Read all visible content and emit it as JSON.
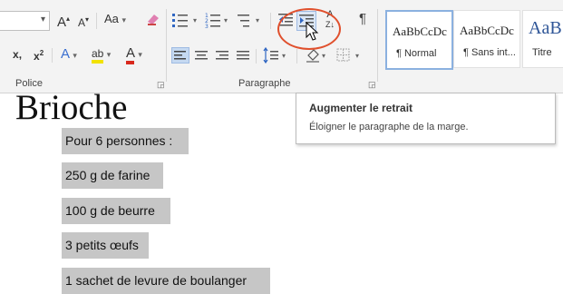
{
  "ribbon": {
    "font_group": {
      "label": "Police",
      "grow_font": "A",
      "shrink_font": "A",
      "change_case": "Aa",
      "subscript": "x",
      "superscript": "x",
      "superscript_mark": "2",
      "text_effects": "A",
      "highlight": "ab",
      "font_color": "A"
    },
    "paragraph_group": {
      "label": "Paragraphe",
      "sort": "A",
      "pilcrow": "¶"
    },
    "styles": [
      {
        "sample": "AaBbCcDc",
        "name": "¶ Normal"
      },
      {
        "sample": "AaBbCcDc",
        "name": "¶ Sans int..."
      },
      {
        "sample": "AaB",
        "name": "Titre"
      }
    ]
  },
  "tooltip": {
    "title": "Augmenter le retrait",
    "description": "Éloigner le paragraphe de la marge."
  },
  "document": {
    "title": "Brioche",
    "paragraphs": [
      "Pour 6 personnes :",
      "250 g de farine",
      "100 g de beurre",
      "3 petits œufs",
      "1 sachet de levure de boulanger"
    ]
  },
  "colors": {
    "highlight_yellow": "#f2e200",
    "font_color_red": "#d8281c",
    "annotation_circle": "#e0502d",
    "selection_gray": "#c6c6c6"
  }
}
